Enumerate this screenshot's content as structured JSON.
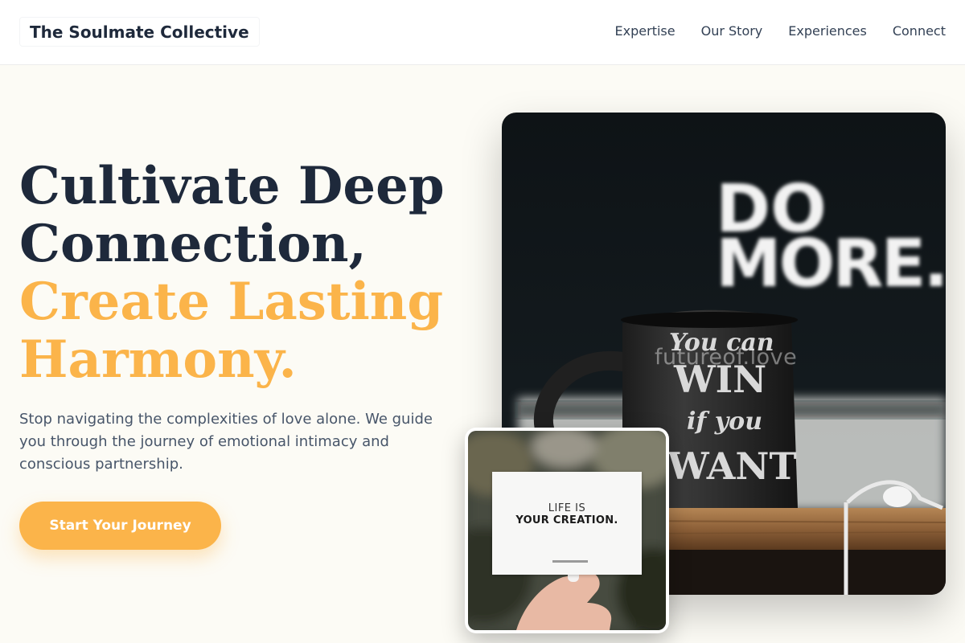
{
  "header": {
    "brand": "The Soulmate Collective",
    "nav": [
      "Expertise",
      "Our Story",
      "Experiences",
      "Connect"
    ]
  },
  "hero": {
    "headline_lines": [
      "Cultivate Deep",
      "Connection,"
    ],
    "accent_lines": [
      "Create Lasting",
      "Harmony."
    ],
    "description": "Stop navigating the complexities of love alone. We guide you through the journey of emotional intimacy and conscious partnership.",
    "cta_label": "Start Your Journey"
  },
  "images": {
    "main": {
      "sign_lines": [
        "DO",
        "MORE."
      ],
      "mug_lines": [
        "You can",
        "WIN",
        "if you",
        "WANT"
      ],
      "watermark": "futureof.love"
    },
    "card": {
      "card_lines": [
        "LIFE IS",
        "YOUR CREATION."
      ]
    }
  },
  "colors": {
    "accent": "#fbb44a",
    "heading": "#1e293b",
    "body_text": "#475569",
    "background": "#fcfbf5"
  }
}
